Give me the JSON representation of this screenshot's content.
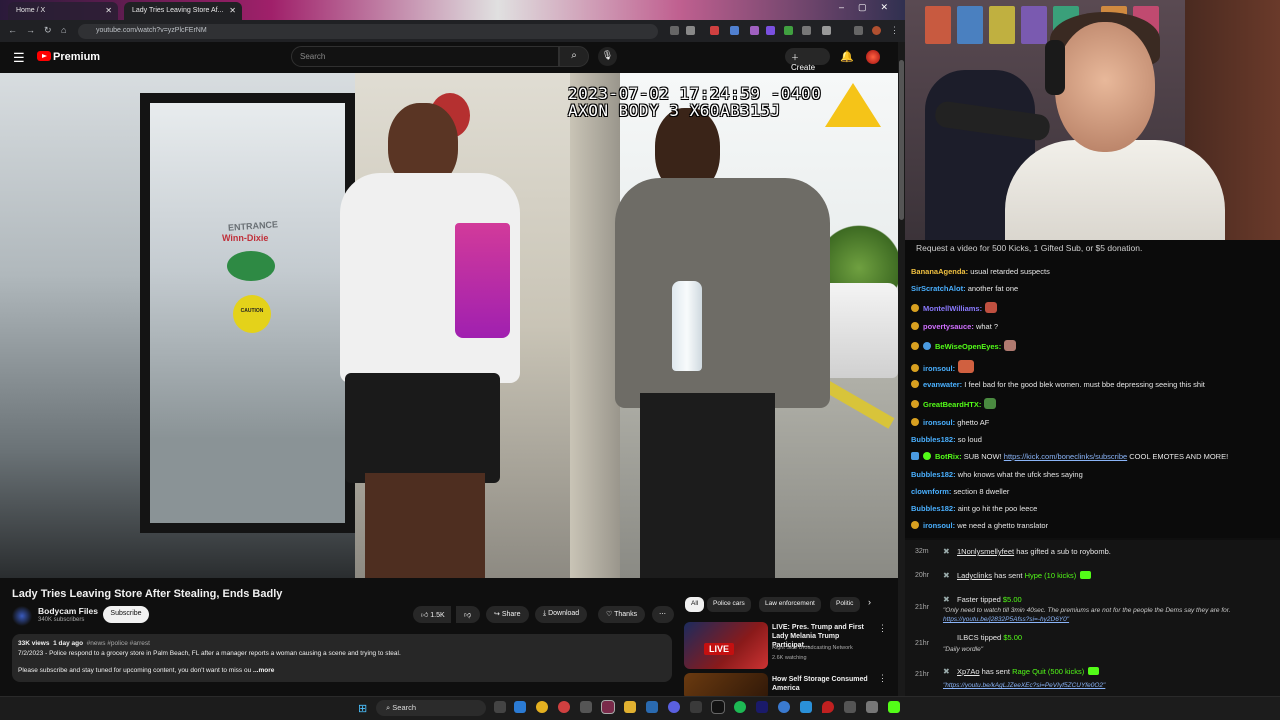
{
  "browser": {
    "tabs": [
      {
        "label": "Home / X"
      },
      {
        "label": "Lady Tries Leaving Store Af..."
      }
    ],
    "url": "youtube.com/watch?v=yzPlcFErNM"
  },
  "youtube": {
    "brand": "Premium",
    "search_placeholder": "Search",
    "create_label": "Create"
  },
  "video": {
    "timestamp_line1": "2023-07-02 17:24:59 -0400",
    "timestamp_line2": "AXON BODY 3 X60AB315J",
    "sign_entrance": "ENTRANCE",
    "sign_store": "Winn-Dixie",
    "sign_caution": "CAUTION"
  },
  "video_info": {
    "title": "Lady Tries Leaving Store After Stealing, Ends Badly",
    "channel": "Bodycam Files",
    "subscribers": "340K subscribers",
    "subscribe_label": "Subscribe",
    "likes": "1.5K",
    "share_label": "Share",
    "download_label": "Download",
    "thanks_label": "Thanks",
    "views": "33K views",
    "age": "1 day ago",
    "hashtags": "#news #police #arrest",
    "desc_line1": "7/2/2023 - Police respond to a grocery store in Palm Beach, FL after a manager reports a woman causing a scene and trying to steal.",
    "desc_line2": "Please subscribe and stay tuned for upcoming content, you don't want to miss ou",
    "more_label": "...more"
  },
  "recommendations": {
    "chips": [
      "All",
      "Police cars",
      "Law enforcement",
      "Politic"
    ],
    "items": [
      {
        "title": "LIVE: Pres. Trump and First Lady Melania Trump Participat...",
        "channel": "Right Side Broadcasting Network",
        "meta": "2.6K watching",
        "badge": "LIVE"
      },
      {
        "title": "How Self Storage Consumed America",
        "channel": "",
        "meta": ""
      }
    ]
  },
  "chat": {
    "banner": "Request a video for 500 Kicks, 1 Gifted Sub, or $5 donation.",
    "messages": [
      {
        "user": "BananaAgenda:",
        "text": "usual retarded suspects",
        "color": "#f0c040"
      },
      {
        "user": "SirScratchAlot:",
        "text": "another fat one",
        "color": "#4ab0ff"
      },
      {
        "user": "MontellWilliams:",
        "text": "",
        "color": "#8a7aff"
      },
      {
        "user": "povertysauce:",
        "text": "what ?",
        "color": "#d070ff"
      },
      {
        "user": "BeWiseOpenEyes:",
        "text": "",
        "color": "#53fc18"
      },
      {
        "user": "ironsoul:",
        "text": "",
        "color": "#4ab0ff"
      },
      {
        "user": "evanwater:",
        "text": "I feel bad for the good blek women. must bbe depressing seeing this shit",
        "color": "#4ab0ff"
      },
      {
        "user": "GreatBeardHTX:",
        "text": "",
        "color": "#53fc18"
      },
      {
        "user": "ironsoul:",
        "text": "ghetto AF",
        "color": "#4ab0ff"
      },
      {
        "user": "Bubbles182:",
        "text": "so loud",
        "color": "#4ab0ff"
      },
      {
        "user": "BotRix:",
        "text": "SUB NOW!",
        "link": "https://kick.com/boneclinks/subscribe",
        "text2": "COOL EMOTES AND MORE!",
        "color": "#53fc18"
      },
      {
        "user": "Bubbles182:",
        "text": "who knows what the ufck shes saying",
        "color": "#4ab0ff"
      },
      {
        "user": "clownform:",
        "text": "section 8 dweller",
        "color": "#4ab0ff"
      },
      {
        "user": "Bubbles182:",
        "text": "aint go hit the poo leece",
        "color": "#4ab0ff"
      },
      {
        "user": "ironsoul:",
        "text": "we need a ghetto translator",
        "color": "#4ab0ff"
      }
    ]
  },
  "events": [
    {
      "time": "32m",
      "user": "1Nonlysmellyfeet",
      "text": "has gifted a sub to",
      "target": "roybomb."
    },
    {
      "time": "20hr",
      "user": "Ladyclinks",
      "text": "has sent",
      "item": "Hype (10 kicks)"
    },
    {
      "time": "21hr",
      "user": "Faster",
      "text": "tipped",
      "item": "$5.00",
      "note": "\"Only need to watch till 3min 40sec. The premiums are not for the people the Dems say they are for.",
      "note2": "https://youtu.be/j2832P5Afss?si=-hy2D6Y0\""
    },
    {
      "time": "21hr",
      "user": "ILBCS",
      "text": "tipped",
      "item": "$5.00",
      "note": "\"Daily wordle\""
    },
    {
      "time": "21hr",
      "user": "Xp7Ao",
      "text": "has sent",
      "item": "Rage Quit (500 kicks)",
      "note": "\"https://youtu.be/kAgLJZeeXEc?si=PeVIyf5ZCUYfe0O2\""
    },
    {
      "time": "21hr",
      "user": "Ladyclinks",
      "text": "has sent",
      "item": "Hype (10 kicks)"
    }
  ],
  "taskbar": {
    "search_label": "Search"
  },
  "colors": {
    "youtube_red": "#ff0000",
    "kick_green": "#53fc18",
    "background": "#0f0f0f"
  }
}
